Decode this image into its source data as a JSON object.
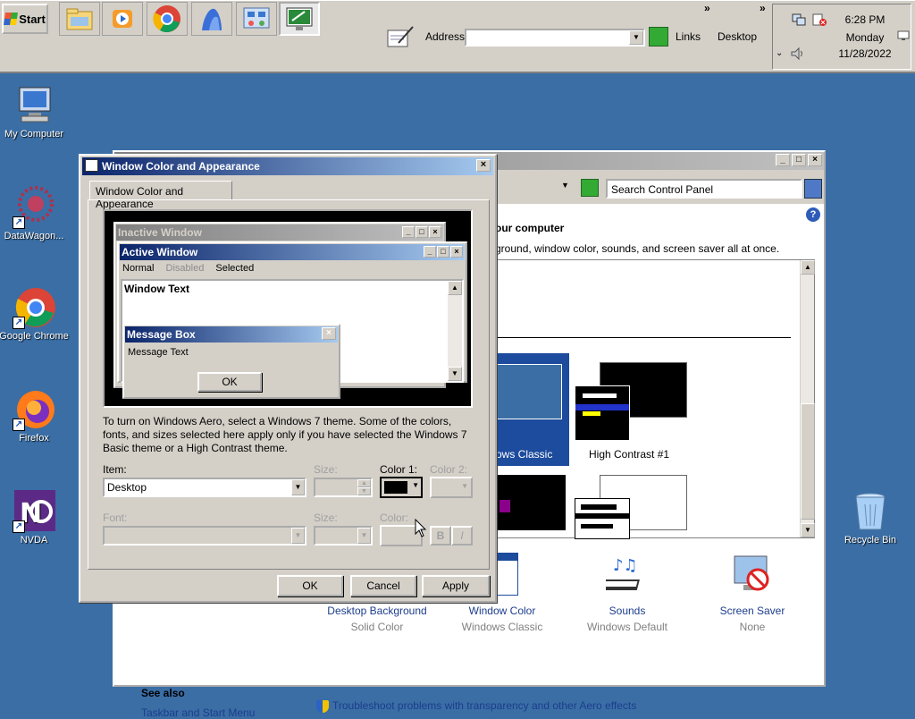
{
  "taskbar": {
    "start_label": "Start",
    "address_label": "Address",
    "address_value": "",
    "links_label": "Links",
    "desktop_label": "Desktop",
    "chevron": "»",
    "clock_time": "6:28 PM",
    "clock_day": "Monday",
    "clock_date": "11/28/2022"
  },
  "desktop_icons": [
    {
      "label": "My Computer"
    },
    {
      "label": "DataWagon..."
    },
    {
      "label": "Google Chrome"
    },
    {
      "label": "Firefox"
    },
    {
      "label": "NVDA"
    },
    {
      "label": "Recycle Bin"
    }
  ],
  "control_panel": {
    "search_placeholder": "Search Control Panel",
    "heading": "our computer",
    "subheading": "ground, window color, sounds, and screen saver all at once.",
    "selected_theme_label": "ows Classic",
    "high_contrast_label": "High Contrast #1",
    "bottom_items": [
      {
        "title": "Desktop Background",
        "subtitle": "Solid Color"
      },
      {
        "title": "Window Color",
        "subtitle": "Windows Classic"
      },
      {
        "title": "Sounds",
        "subtitle": "Windows Default"
      },
      {
        "title": "Screen Saver",
        "subtitle": "None"
      }
    ],
    "see_also": "See also",
    "see_also_link": "Taskbar and Start Menu",
    "troubleshoot_link": "Troubleshoot problems with transparency and other Aero effects"
  },
  "dialog": {
    "title": "Window Color and Appearance",
    "tab_label": "Window Color and Appearance",
    "preview": {
      "inactive_title": "Inactive Window",
      "active_title": "Active Window",
      "menu_normal": "Normal",
      "menu_disabled": "Disabled",
      "menu_selected": "Selected",
      "window_text": "Window Text",
      "msgbox_title": "Message Box",
      "msgbox_text": "Message Text",
      "msgbox_ok": "OK"
    },
    "instructions": "To turn on Windows Aero, select a Windows 7 theme.  Some of the colors, fonts, and sizes selected here apply only if you have selected the Windows 7 Basic theme or a High Contrast theme.",
    "item_label": "Item:",
    "item_value": "Desktop",
    "size_label": "Size:",
    "color1_label": "Color 1:",
    "color2_label": "Color 2:",
    "font_label": "Font:",
    "font_size_label": "Size:",
    "font_color_label": "Color:",
    "bold_label": "B",
    "italic_label": "I",
    "color1_value": "#000000",
    "ok_label": "OK",
    "cancel_label": "Cancel",
    "apply_label": "Apply"
  }
}
